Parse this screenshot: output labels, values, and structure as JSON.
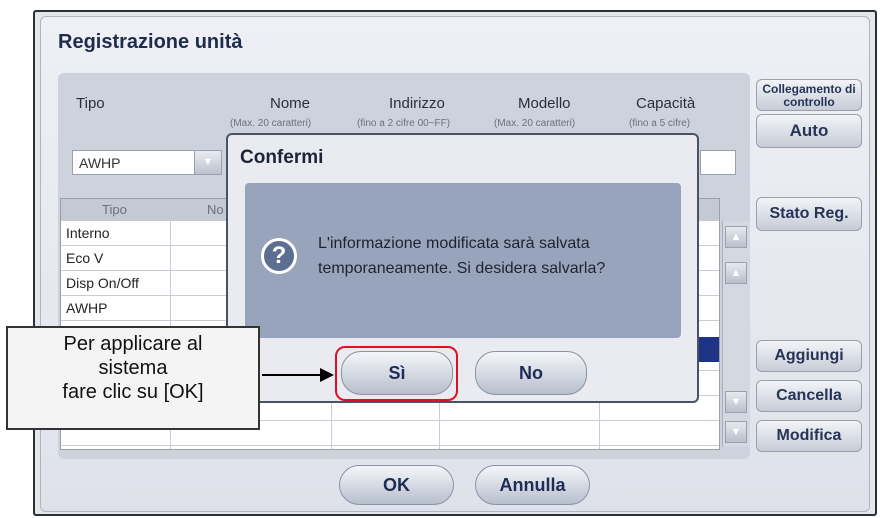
{
  "window": {
    "title": "Registrazione unità"
  },
  "form": {
    "headers": [
      {
        "label": "Tipo",
        "hint": ""
      },
      {
        "label": "Nome",
        "hint": "(Max. 20 caratteri)"
      },
      {
        "label": "Indirizzo",
        "hint": "(fino a 2 cifre 00~FF)"
      },
      {
        "label": "Modello",
        "hint": "(Max. 20 caratteri)"
      },
      {
        "label": "Capacità",
        "hint": "(fino a 5 cifre)"
      }
    ],
    "type_value": "AWHP"
  },
  "grid": {
    "columns": [
      "Tipo",
      "No"
    ],
    "rows": [
      "Interno",
      "Eco V",
      "Disp On/Off",
      "AWHP",
      "",
      "",
      ""
    ]
  },
  "side_buttons": {
    "collegamento": "Collegamento di controllo",
    "auto": "Auto",
    "stato": "Stato Reg.",
    "aggiungi": "Aggiungi",
    "cancella": "Cancella",
    "modifica": "Modifica"
  },
  "bottom_buttons": {
    "ok": "OK",
    "annulla": "Annulla"
  },
  "dialog": {
    "title": "Confermi",
    "message_line1": "L'informazione modificata sarà salvata",
    "message_line2": "temporaneamente. Si desidera salvarla?",
    "yes": "Sì",
    "no": "No"
  },
  "callout": {
    "line1": "Per applicare al",
    "line2": "sistema",
    "line3": "fare clic su [OK]"
  },
  "colors": {
    "highlight": "#e01020",
    "accent": "#1f2c55",
    "dialog_panel": "#98a4bb"
  },
  "icons": {
    "question": "question-circle-icon",
    "scroll_up": "double-chevron-up-icon",
    "scroll_down": "double-chevron-down-icon"
  }
}
